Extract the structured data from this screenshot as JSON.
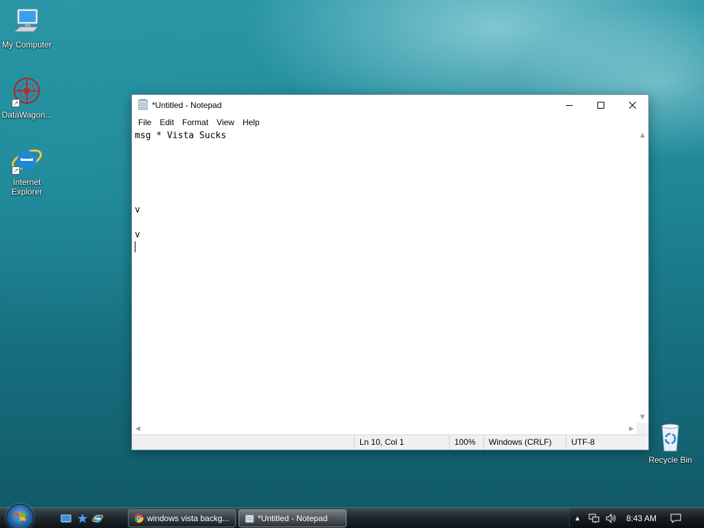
{
  "desktop": {
    "icons": [
      {
        "label": "My Computer"
      },
      {
        "label": "DataWagon..."
      },
      {
        "label": "Internet Explorer"
      },
      {
        "label": "Recycle Bin"
      }
    ]
  },
  "notepad": {
    "title": "*Untitled - Notepad",
    "menu": [
      "File",
      "Edit",
      "Format",
      "View",
      "Help"
    ],
    "content": "msg * Vista Sucks\n\n\n\n\n\nv\n\nv\n",
    "status": {
      "position": "Ln 10, Col 1",
      "zoom": "100%",
      "line_ending": "Windows (CRLF)",
      "encoding": "UTF-8"
    }
  },
  "taskbar": {
    "tasks": [
      {
        "label": "windows vista backg...",
        "icon": "chrome-icon"
      },
      {
        "label": "*Untitled - Notepad",
        "icon": "notepad-icon"
      }
    ],
    "clock": "8:43 AM"
  },
  "colors": {
    "desktop": "#1f8797",
    "taskbar": "#1d262c"
  }
}
